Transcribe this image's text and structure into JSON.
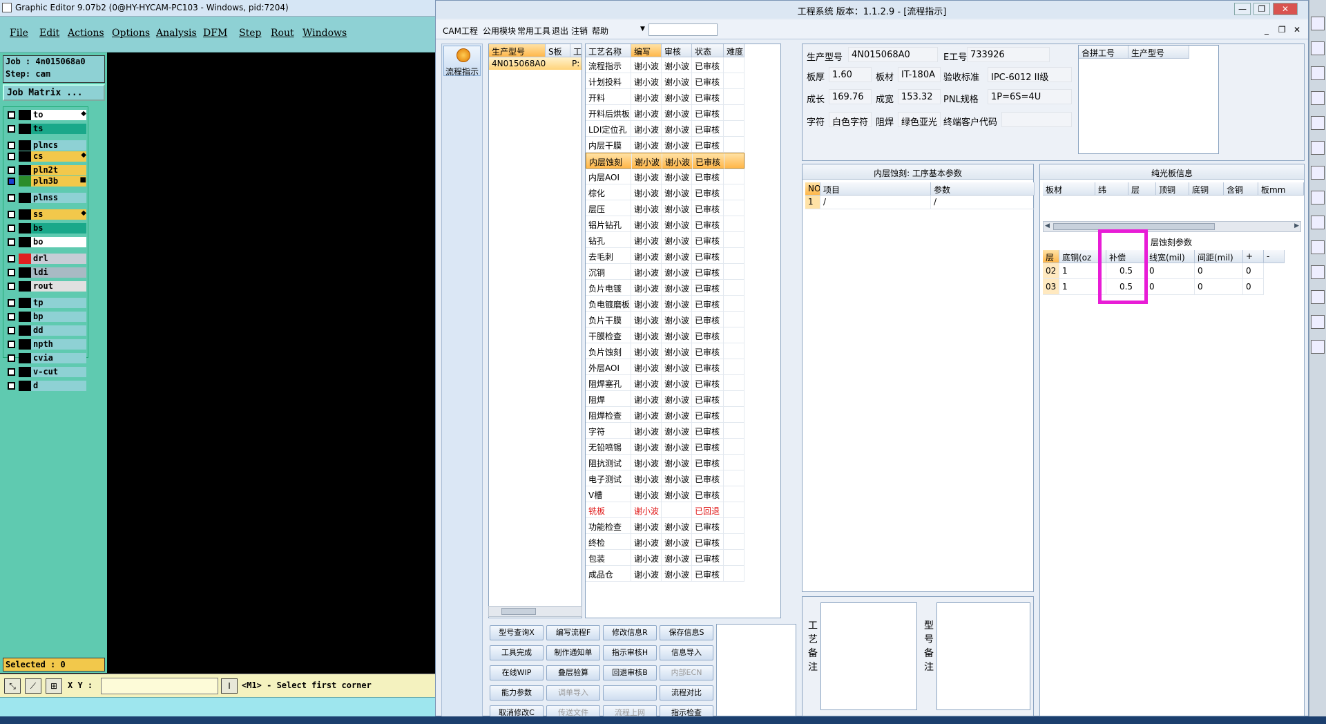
{
  "graphic_editor": {
    "title": "Graphic Editor 9.07b2 (0@HY-HYCAM-PC103 - Windows, pid:7204)",
    "menu": [
      "File",
      "Edit",
      "Actions",
      "Options",
      "Analysis",
      "DFM",
      "Step",
      "Rout",
      "Windows"
    ],
    "job_line": "Job : 4n015068a0",
    "step_line": "Step: cam",
    "job_matrix_label": "Job Matrix ...",
    "layers": [
      {
        "name": "to",
        "bg": "#ffffff",
        "tag": "◆"
      },
      {
        "name": "ts",
        "bg": "#1aa88a",
        "tag": ""
      },
      {
        "name": "plncs",
        "bg": "#8ed1d4",
        "tag": ""
      },
      {
        "name": "cs",
        "bg": "#f2c84b",
        "tag": "◆"
      },
      {
        "name": "pln2t",
        "bg": "#f2c84b",
        "tag": ""
      },
      {
        "name": "pln3b",
        "bg": "#f2c84b",
        "tag": "■"
      },
      {
        "name": "plnss",
        "bg": "#8ed1d4",
        "tag": ""
      },
      {
        "name": "ss",
        "bg": "#f2c84b",
        "tag": "◆"
      },
      {
        "name": "bs",
        "bg": "#1aa88a",
        "tag": ""
      },
      {
        "name": "bo",
        "bg": "#ffffff",
        "tag": ""
      },
      {
        "name": "drl",
        "bg": "#c7cdd6",
        "tag": ""
      },
      {
        "name": "ldi",
        "bg": "#a8bac4",
        "tag": ""
      },
      {
        "name": "rout",
        "bg": "#e0e0e0",
        "tag": ""
      },
      {
        "name": "tp",
        "bg": "#8ed1d4",
        "tag": ""
      },
      {
        "name": "bp",
        "bg": "#8ed1d4",
        "tag": ""
      },
      {
        "name": "dd",
        "bg": "#8ed1d4",
        "tag": ""
      },
      {
        "name": "npth",
        "bg": "#8ed1d4",
        "tag": ""
      },
      {
        "name": "cvia",
        "bg": "#8ed1d4",
        "tag": ""
      },
      {
        "name": "v-cut",
        "bg": "#8ed1d4",
        "tag": ""
      },
      {
        "name": "d",
        "bg": "#8ed1d4",
        "tag": ""
      }
    ],
    "selected_label": "Selected : 0",
    "xy_label": "X Y :",
    "xy_value": "",
    "status_message": "<M1> - Select first corner"
  },
  "cam": {
    "title": "工程系统   版本：1.1.2.9 - [流程指示]",
    "menu": [
      "CAM工程",
      "公用模块",
      "常用工具",
      "退出",
      "注销",
      "帮助"
    ],
    "nav_button": "流程指示",
    "orders_headers": [
      "生产型号",
      "S板",
      "工"
    ],
    "order_row": "4N015068A0",
    "order_row_extra": "P:",
    "process_headers": [
      "工艺名称",
      "编写",
      "审核",
      "状态",
      "难度"
    ],
    "process_rows": [
      [
        "流程指示",
        "谢小波",
        "谢小波",
        "已审核"
      ],
      [
        "计划投料",
        "谢小波",
        "谢小波",
        "已审核"
      ],
      [
        "开料",
        "谢小波",
        "谢小波",
        "已审核"
      ],
      [
        "开料后烘板",
        "谢小波",
        "谢小波",
        "已审核"
      ],
      [
        "LDI定位孔",
        "谢小波",
        "谢小波",
        "已审核"
      ],
      [
        "内层干膜",
        "谢小波",
        "谢小波",
        "已审核"
      ],
      [
        "内层蚀刻",
        "谢小波",
        "谢小波",
        "已审核"
      ],
      [
        "内层AOI",
        "谢小波",
        "谢小波",
        "已审核"
      ],
      [
        "棕化",
        "谢小波",
        "谢小波",
        "已审核"
      ],
      [
        "层压",
        "谢小波",
        "谢小波",
        "已审核"
      ],
      [
        "铝片钻孔",
        "谢小波",
        "谢小波",
        "已审核"
      ],
      [
        "钻孔",
        "谢小波",
        "谢小波",
        "已审核"
      ],
      [
        "去毛刺",
        "谢小波",
        "谢小波",
        "已审核"
      ],
      [
        "沉铜",
        "谢小波",
        "谢小波",
        "已审核"
      ],
      [
        "负片电镀",
        "谢小波",
        "谢小波",
        "已审核"
      ],
      [
        "负电镀磨板",
        "谢小波",
        "谢小波",
        "已审核"
      ],
      [
        "负片干膜",
        "谢小波",
        "谢小波",
        "已审核"
      ],
      [
        "干膜检查",
        "谢小波",
        "谢小波",
        "已审核"
      ],
      [
        "负片蚀刻",
        "谢小波",
        "谢小波",
        "已审核"
      ],
      [
        "外层AOI",
        "谢小波",
        "谢小波",
        "已审核"
      ],
      [
        "阻焊塞孔",
        "谢小波",
        "谢小波",
        "已审核"
      ],
      [
        "阻焊",
        "谢小波",
        "谢小波",
        "已审核"
      ],
      [
        "阻焊检查",
        "谢小波",
        "谢小波",
        "已审核"
      ],
      [
        "字符",
        "谢小波",
        "谢小波",
        "已审核"
      ],
      [
        "无铅喷锡",
        "谢小波",
        "谢小波",
        "已审核"
      ],
      [
        "阻抗测试",
        "谢小波",
        "谢小波",
        "已审核"
      ],
      [
        "电子测试",
        "谢小波",
        "谢小波",
        "已审核"
      ],
      [
        "V槽",
        "谢小波",
        "谢小波",
        "已审核"
      ],
      [
        "铣板",
        "谢小波",
        "",
        "已回退"
      ],
      [
        "功能检查",
        "谢小波",
        "谢小波",
        "已审核"
      ],
      [
        "终检",
        "谢小波",
        "谢小波",
        "已审核"
      ],
      [
        "包装",
        "谢小波",
        "谢小波",
        "已审核"
      ],
      [
        "成品仓",
        "谢小波",
        "谢小波",
        "已审核"
      ]
    ],
    "info": {
      "l_model": "生产型号",
      "v_model": "4N015068A0",
      "l_eno": "E工号",
      "v_eno": "733926",
      "l_thick": "板厚",
      "v_thick": "1.60",
      "l_mat": "板材",
      "v_mat": "IT-180A",
      "l_std": "验收标准",
      "v_std": "IPC-6012 II级",
      "l_len": "成长",
      "v_len": "169.76",
      "l_wid": "成宽",
      "v_wid": "153.32",
      "l_pnl": "PNL规格",
      "v_pnl": "1P=6S=4U",
      "l_char": "字符",
      "v_char": "白色字符",
      "l_mask": "阻焊",
      "v_mask": "绿色亚光",
      "l_cust": "终端客户代码",
      "v_cust": ""
    },
    "merge_headers": [
      "合拼工号",
      "生产型号"
    ],
    "param_title": "内层蚀刻: 工序基本参数",
    "param_headers": [
      "NO",
      "项目",
      "参数"
    ],
    "param_row": [
      "1",
      "/",
      "/"
    ],
    "optical_title": "纯光板信息",
    "optical_headers": [
      "板材",
      "纬",
      "层",
      "顶铜",
      "底铜",
      "含铜",
      "板mm"
    ],
    "etch_title": "层蚀刻参数",
    "etch_headers": [
      "层",
      "底铜(oz",
      "补偿",
      "线宽(mil)",
      "间距(mil)",
      "+",
      "-"
    ],
    "etch_rows": [
      [
        "02",
        "1",
        "0.5",
        "0",
        "0",
        "0"
      ],
      [
        "03",
        "1",
        "0.5",
        "0",
        "0",
        "0"
      ]
    ],
    "remark_process": "工艺备注",
    "remark_model": "型号备注",
    "buttons": [
      {
        "label": "型号查询X",
        "enabled": true
      },
      {
        "label": "编写流程F",
        "enabled": true
      },
      {
        "label": "修改信息R",
        "enabled": true
      },
      {
        "label": "保存信息S",
        "enabled": true
      },
      {
        "label": "工具完成",
        "enabled": true
      },
      {
        "label": "制作通知单",
        "enabled": true
      },
      {
        "label": "指示审核H",
        "enabled": true
      },
      {
        "label": "信息导入",
        "enabled": true
      },
      {
        "label": "在线WIP",
        "enabled": true
      },
      {
        "label": "叠层验算",
        "enabled": true
      },
      {
        "label": "回退审核B",
        "enabled": true
      },
      {
        "label": "内部ECN",
        "enabled": false
      },
      {
        "label": "能力参数",
        "enabled": true
      },
      {
        "label": "调单导入",
        "enabled": false
      },
      {
        "label": "",
        "enabled": true
      },
      {
        "label": "流程对比",
        "enabled": true
      },
      {
        "label": "取消修改C",
        "enabled": true
      },
      {
        "label": "传送文件",
        "enabled": false
      },
      {
        "label": "流程上网",
        "enabled": false
      },
      {
        "label": "指示检查",
        "enabled": true
      }
    ]
  }
}
